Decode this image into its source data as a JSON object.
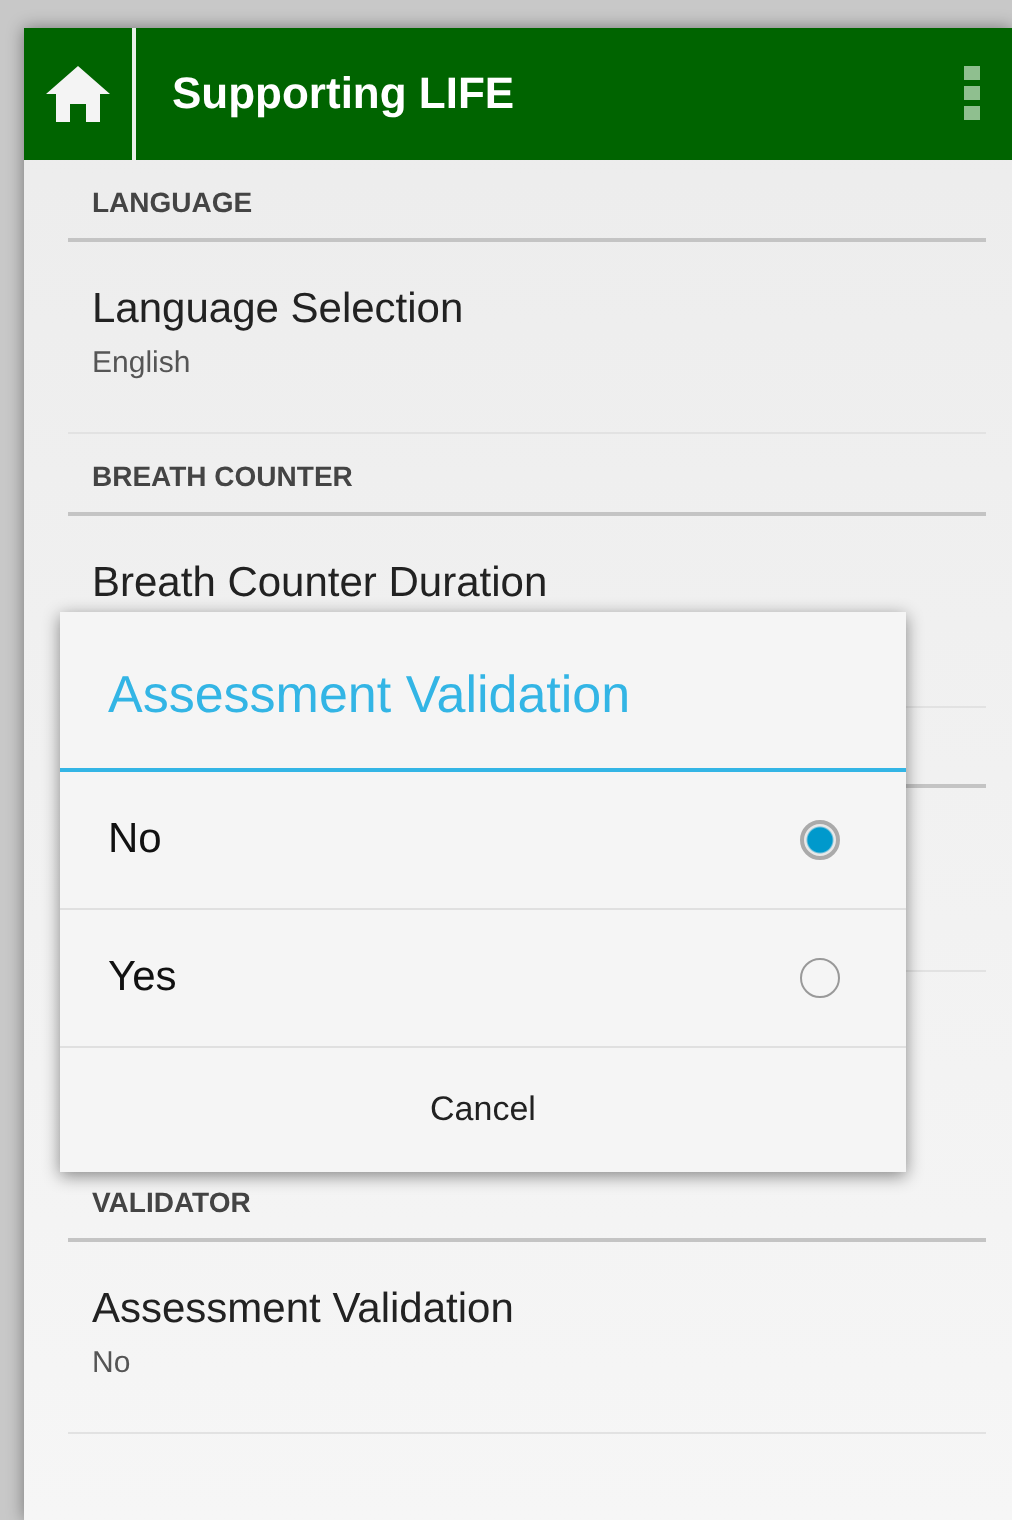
{
  "app_bar": {
    "title": "Supporting LIFE"
  },
  "sections": [
    {
      "header": "LANGUAGE",
      "items": [
        {
          "title": "Language Selection",
          "value": "English"
        }
      ]
    },
    {
      "header": "BREATH COUNTER",
      "items": [
        {
          "title": "Breath Counter Duration"
        }
      ]
    },
    {
      "header": "VALIDATOR",
      "items": [
        {
          "title": "Assessment Validation",
          "value": "No"
        }
      ]
    }
  ],
  "dialog": {
    "title": "Assessment Validation",
    "options": [
      {
        "label": "No",
        "selected": true
      },
      {
        "label": "Yes",
        "selected": false
      }
    ],
    "button": "Cancel"
  }
}
